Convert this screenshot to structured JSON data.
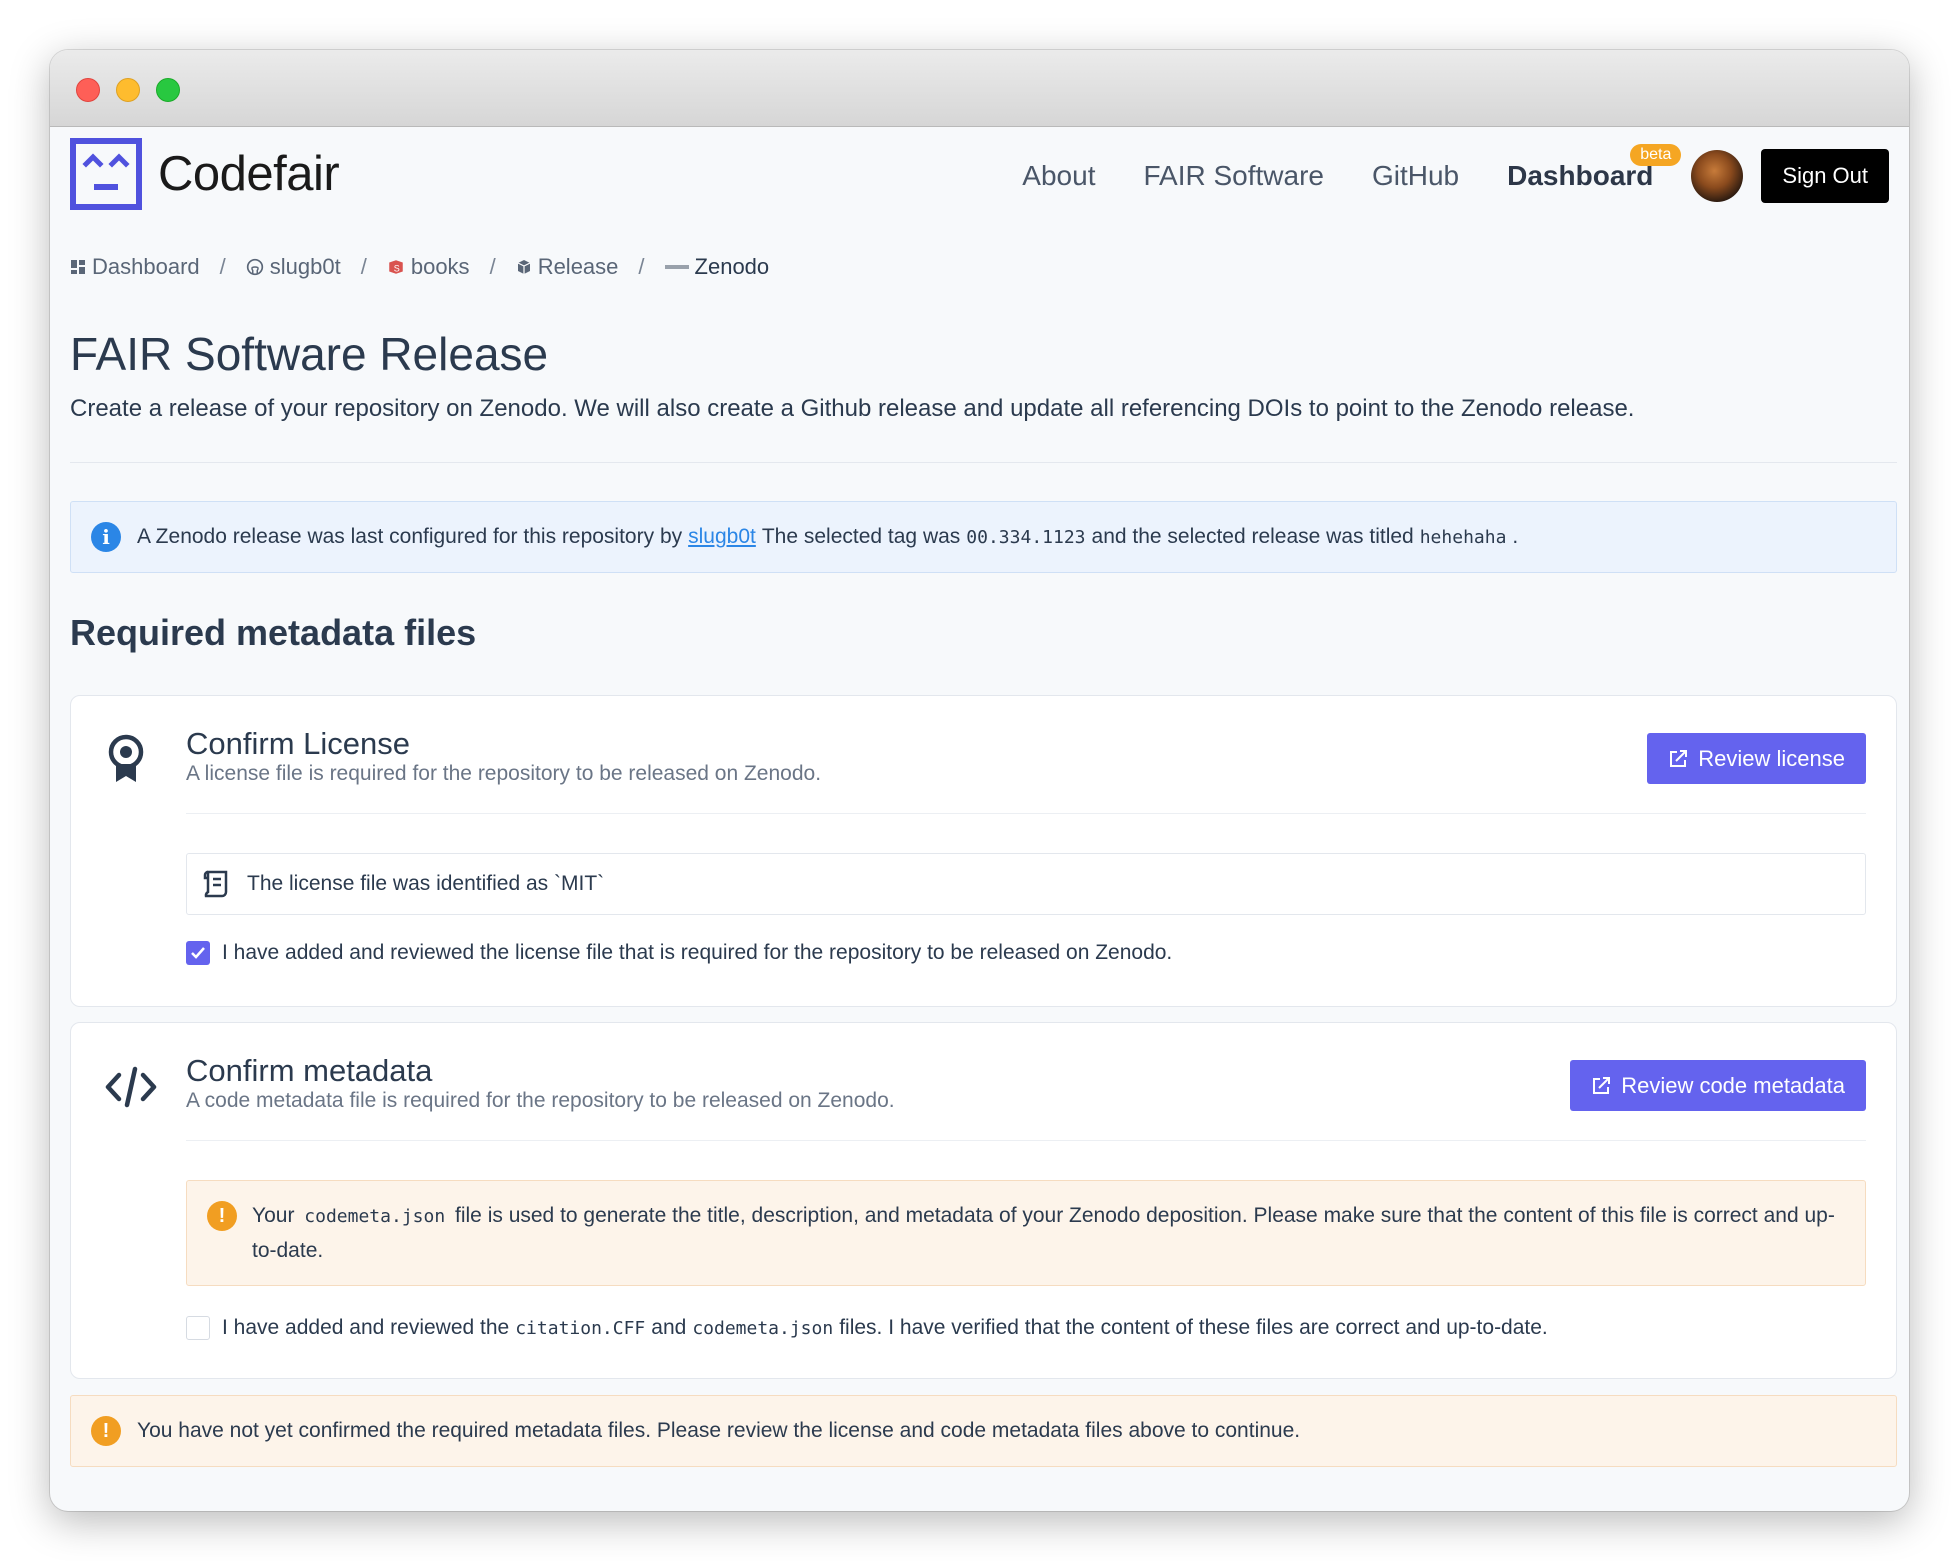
{
  "nav": {
    "brand": "Codefair",
    "links": [
      "About",
      "FAIR Software",
      "GitHub"
    ],
    "dashboard": "Dashboard",
    "beta_badge": "beta",
    "sign_out": "Sign Out"
  },
  "breadcrumb": [
    "Dashboard",
    "slugb0t",
    "books",
    "Release",
    "Zenodo"
  ],
  "page": {
    "title": "FAIR Software Release",
    "subtitle": "Create a release of your repository on Zenodo. We will also create a Github release and update all referencing DOIs to point to the Zenodo release."
  },
  "info": {
    "prefix": "A Zenodo release was last configured for this repository by",
    "user": "slugb0t",
    "tag_text": "The selected tag was",
    "tag": "00.334.1123",
    "title_text": "and the selected release was titled",
    "release_title": "hehehaha",
    "suffix": "."
  },
  "section_title": "Required metadata files",
  "license_card": {
    "title": "Confirm License",
    "description": "A license file is required for the repository to be released on Zenodo.",
    "button": "Review license",
    "identified": "The license file was identified as `MIT`",
    "checkbox_label": "I have added and reviewed the license file that is required for the repository to be released on Zenodo.",
    "checked": true
  },
  "metadata_card": {
    "title": "Confirm metadata",
    "description": "A code metadata file is required for the repository to be released on Zenodo.",
    "button": "Review code metadata",
    "warn_prefix": "Your",
    "warn_file": "codemeta.json",
    "warn_suffix": "file is used to generate the title, description, and metadata of your Zenodo deposition. Please make sure that the content of this file is correct and up-to-date.",
    "check_prefix": "I have added and reviewed the",
    "check_file1": "citation.CFF",
    "check_and": "and",
    "check_file2": "codemeta.json",
    "check_suffix": "files. I have verified that the content of these files are correct and up-to-date.",
    "checked": false
  },
  "bottom_warning": "You have not yet confirmed the required metadata files. Please review the license and code metadata files above to continue.",
  "colors": {
    "primary": "#6463ee",
    "info": "#2b86e6",
    "warning": "#f19e22",
    "beta": "#f5a623"
  }
}
